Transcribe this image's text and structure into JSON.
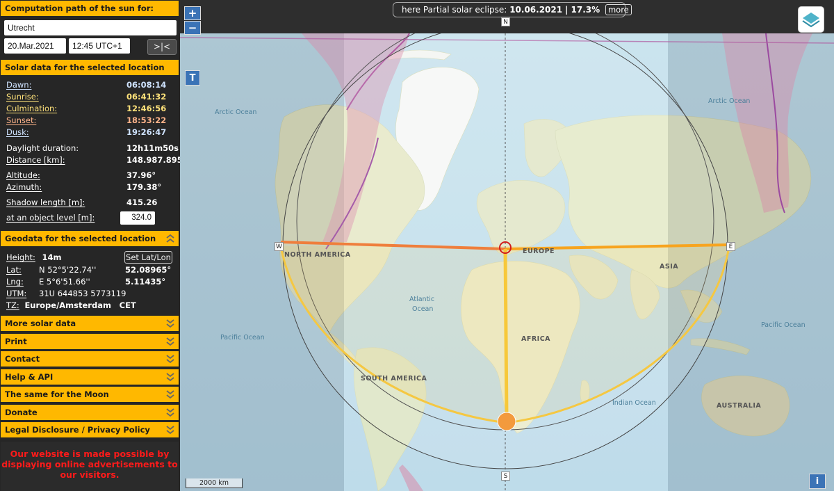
{
  "header": {
    "title": "Computation path of the sun for:"
  },
  "location": {
    "place": "Utrecht",
    "date": "20.Mar.2021",
    "time": "12:45 UTC+1",
    "now_button": ">|<"
  },
  "solar": {
    "title": "Solar data for the selected location",
    "dawn": {
      "label": "Dawn:",
      "value": "06:08:14"
    },
    "sunrise": {
      "label": "Sunrise:",
      "value": "06:41:32"
    },
    "culmination": {
      "label": "Culmination:",
      "value": "12:46:56"
    },
    "sunset": {
      "label": "Sunset:",
      "value": "18:53:22"
    },
    "dusk": {
      "label": "Dusk:",
      "value": "19:26:47"
    },
    "daylight": {
      "label": "Daylight duration:",
      "value": "12h11m50s"
    },
    "distance": {
      "label": "Distance [km]:",
      "value": "148.987.895"
    },
    "altitude": {
      "label": "Altitude:",
      "value": "37.96°"
    },
    "azimuth": {
      "label": "Azimuth:",
      "value": "179.38°"
    },
    "shadow": {
      "label": "Shadow length [m]:",
      "value": "415.26"
    },
    "object_level": {
      "label": "at an object level [m]:",
      "value": "324.0"
    }
  },
  "geodata": {
    "title": "Geodata for the selected location",
    "height_label": "Height:",
    "height_value": "14m",
    "set_latlon": "Set Lat/Lon",
    "lat_label": "Lat:",
    "lat_dms": "N 52°5'22.74''",
    "lat_dec": "52.08965°",
    "lng_label": "Lng:",
    "lng_dms": "E 5°6'51.66''",
    "lng_dec": "5.11435°",
    "utm_label": "UTM:",
    "utm_value": "31U 644853 5773119",
    "tz_label": "TZ:",
    "tz_value": "Europe/Amsterdam",
    "tz_abbr": "CET"
  },
  "menu": [
    "More solar data",
    "Print",
    "Contact",
    "Help & API",
    "The same for the Moon",
    "Donate",
    "Legal Disclosure / Privacy Policy"
  ],
  "ad_notice": "Our website is made possible by displaying online advertisements to our visitors.",
  "map": {
    "zoom_in": "+",
    "zoom_out": "−",
    "terrain_button": "T",
    "info_button": "i",
    "scale": "2000 km",
    "eclipse_prefix": "here Partial solar eclipse:",
    "eclipse_date": "10.06.2021",
    "eclipse_pct": "17.3%",
    "eclipse_more": "more",
    "compass": {
      "n": "N",
      "s": "S",
      "w": "W",
      "e": "E"
    },
    "labels": {
      "arctic_left": "Arctic Ocean",
      "arctic_right": "Arctic Ocean",
      "north_america": "NORTH AMERICA",
      "europe": "EUROPE",
      "asia": "ASIA",
      "atlantic1": "Atlantic",
      "atlantic2": "Ocean",
      "pacific_left": "Pacific Ocean",
      "pacific_right": "Pacific Ocean",
      "africa": "AFRICA",
      "south_america": "SOUTH AMERICA",
      "indian": "Indian Ocean",
      "australia": "AUSTRALIA"
    },
    "colors": {
      "header_yellow": "#ffb800",
      "sun_path": "#f5c842",
      "sun_direction": "#f7a41f",
      "sunrise_line": "#ef7e3c",
      "location_marker": "#d11c1c"
    }
  }
}
